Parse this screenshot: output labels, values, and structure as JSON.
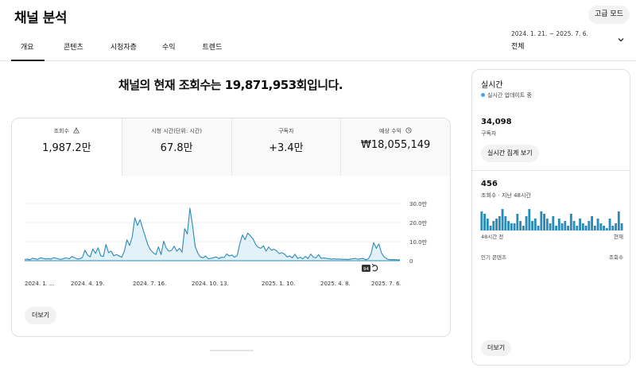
{
  "header": {
    "title": "채널 분석",
    "advanced_mode": "고급 모드",
    "tabs": [
      "개요",
      "콘텐츠",
      "시청자층",
      "수익",
      "트렌드"
    ],
    "date_range": "2024. 1. 21. ~ 2025. 7. 6.",
    "date_label": "전체"
  },
  "headline": "채널의 현재 조회수는 19,871,953회입니다.",
  "metrics": [
    {
      "label": "조회수",
      "value": "1,987.2만",
      "icon": "warning-icon"
    },
    {
      "label": "시청 시간(단위: 시간)",
      "value": "67.8만"
    },
    {
      "label": "구독자",
      "value": "+3.4만"
    },
    {
      "label": "예상 수익",
      "value": "₩18,055,149",
      "icon": "clock-icon"
    }
  ],
  "chart_data": {
    "type": "area",
    "x_tick_labels": [
      "2024. 1. ...",
      "2024. 4. 19.",
      "2024. 7. 16.",
      "2024. 10. 13.",
      "2025. 1. 10.",
      "2025. 4. 8.",
      "2025. 7. 6."
    ],
    "y_tick_labels": [
      "30.0만",
      "20.0만",
      "10.0만",
      "0"
    ],
    "ylim": [
      0,
      30
    ],
    "y_unit": "만",
    "grid": true,
    "accent": "#2a8bb8",
    "fill": "#e3f1f8",
    "series": [
      {
        "values": [
          0.6,
          0.8,
          0.5,
          1.3,
          1,
          0.7,
          1.5,
          1.2,
          0.9,
          1.1,
          0.8,
          1.6,
          1.3,
          0.9,
          0.7,
          1.2,
          1.4,
          1,
          2.2,
          1.6,
          0.9,
          1,
          1.7,
          5.5,
          3,
          2,
          6.2,
          3.8,
          6.8,
          2.6,
          2.2,
          8.5,
          4.2,
          5,
          2.6,
          3.2,
          2.5,
          1.8,
          5,
          11,
          8,
          12.5,
          22.5,
          18.5,
          21.5,
          17,
          12.5,
          8.2,
          5.6,
          4.2,
          3.2,
          7.3,
          3.2,
          10.2,
          6.5,
          5,
          5.4,
          7.6,
          5,
          6.5,
          4.5,
          16.8,
          14,
          27.5,
          18.5,
          7.5,
          4,
          2,
          1.5,
          2.5,
          1,
          1.2,
          1.6,
          2,
          1.1,
          1.8,
          1.7,
          3.5,
          2.5,
          3,
          1.8,
          2.8,
          9,
          13.5,
          11,
          14.5,
          13,
          11.5,
          8.6,
          7,
          6.5,
          7.8,
          5,
          7.2,
          5.5,
          6,
          5.2,
          3.7,
          4.2,
          3.5,
          2,
          2.5,
          1.5,
          3.4,
          1.2,
          1.8,
          1,
          2.3,
          1.1,
          3.5,
          2,
          1.4,
          3.2,
          1.2,
          1.4,
          1.2,
          1,
          0.8,
          1,
          0.8,
          0.9,
          0.7,
          0.8,
          0.6,
          0.8,
          1,
          1.2,
          0.8,
          1,
          1.2,
          0.5,
          1,
          3.5,
          9.5,
          6.5,
          8.8,
          4,
          2,
          1,
          0.6,
          0.5,
          0.6,
          0.4,
          0.5
        ]
      }
    ],
    "markers": [
      "94",
      "refresh-icon"
    ]
  },
  "more_button": "더보기",
  "realtime": {
    "title": "실시간",
    "status": "실시간 업데이트 중",
    "subscribers_value": "34,098",
    "subscribers_label": "구독자",
    "live_count_button": "실시간 집계 보기",
    "views48_value": "456",
    "views48_label": "조회수 · 지난 48시간",
    "bar_values": [
      8,
      7,
      5,
      2,
      4,
      5,
      6,
      9,
      6,
      4,
      3,
      3,
      7,
      4,
      2,
      6,
      9,
      4,
      5,
      2,
      8,
      7,
      5,
      3,
      6,
      2,
      5,
      3,
      4,
      2,
      7,
      4,
      2,
      5,
      3,
      2,
      4,
      6,
      2,
      5,
      3,
      2,
      1,
      5,
      2,
      3,
      8,
      3
    ],
    "bar_max": 10,
    "bars_left_label": "48시간 전",
    "bars_right_label": "현재",
    "popular_label": "인기 콘텐츠",
    "popular_column": "조회수",
    "more_button": "더보기"
  }
}
